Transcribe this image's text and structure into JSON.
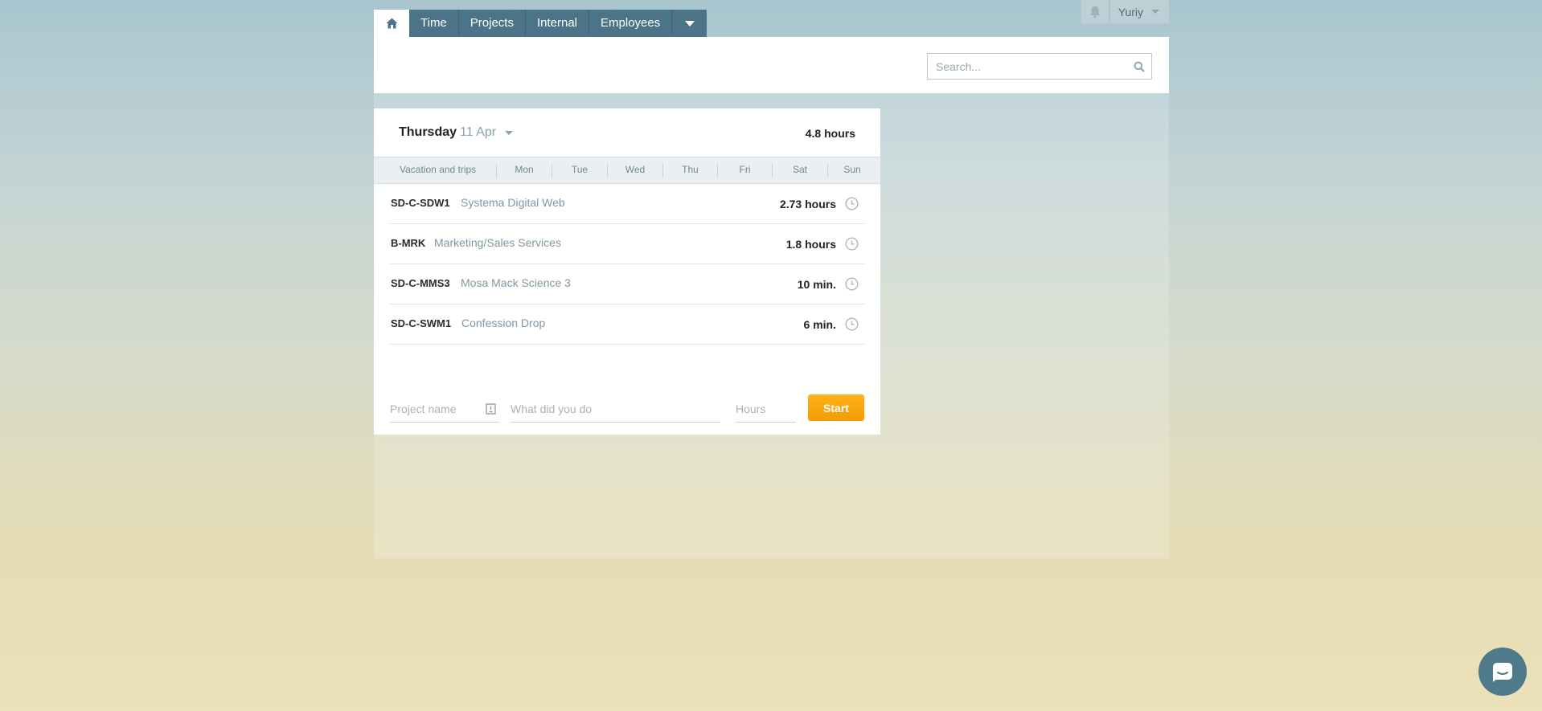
{
  "nav": {
    "home_icon": "home-icon",
    "items": [
      {
        "label": "Time"
      },
      {
        "label": "Projects"
      },
      {
        "label": "Internal"
      },
      {
        "label": "Employees"
      }
    ],
    "more_icon": "chevron-down-icon"
  },
  "user": {
    "notifications_icon": "bell-icon",
    "name": "Yuriy"
  },
  "search": {
    "placeholder": "Search..."
  },
  "day": {
    "name": "Thursday",
    "date": "11 Apr",
    "total": "4.8 hours"
  },
  "week": {
    "vacation_label": "Vacation and trips",
    "days": [
      "Mon",
      "Tue",
      "Wed",
      "Thu",
      "Fri",
      "Sat",
      "Sun"
    ]
  },
  "entries": [
    {
      "code": "SD-C-SDW1",
      "name": "Systema Digital Web",
      "hours": "2.73 hours"
    },
    {
      "code": "B-MRK",
      "name": "Marketing/Sales Services",
      "hours": "1.8 hours"
    },
    {
      "code": "SD-C-MMS3",
      "name": "Mosa Mack Science 3",
      "hours": "10 min."
    },
    {
      "code": "SD-C-SWM1",
      "name": "Confession Drop",
      "hours": "6 min."
    }
  ],
  "form": {
    "project_placeholder": "Project name",
    "description_placeholder": "What did you do",
    "hours_placeholder": "Hours",
    "start_label": "Start"
  },
  "colors": {
    "nav_bg": "#4b7488",
    "accent": "#f59b00"
  }
}
